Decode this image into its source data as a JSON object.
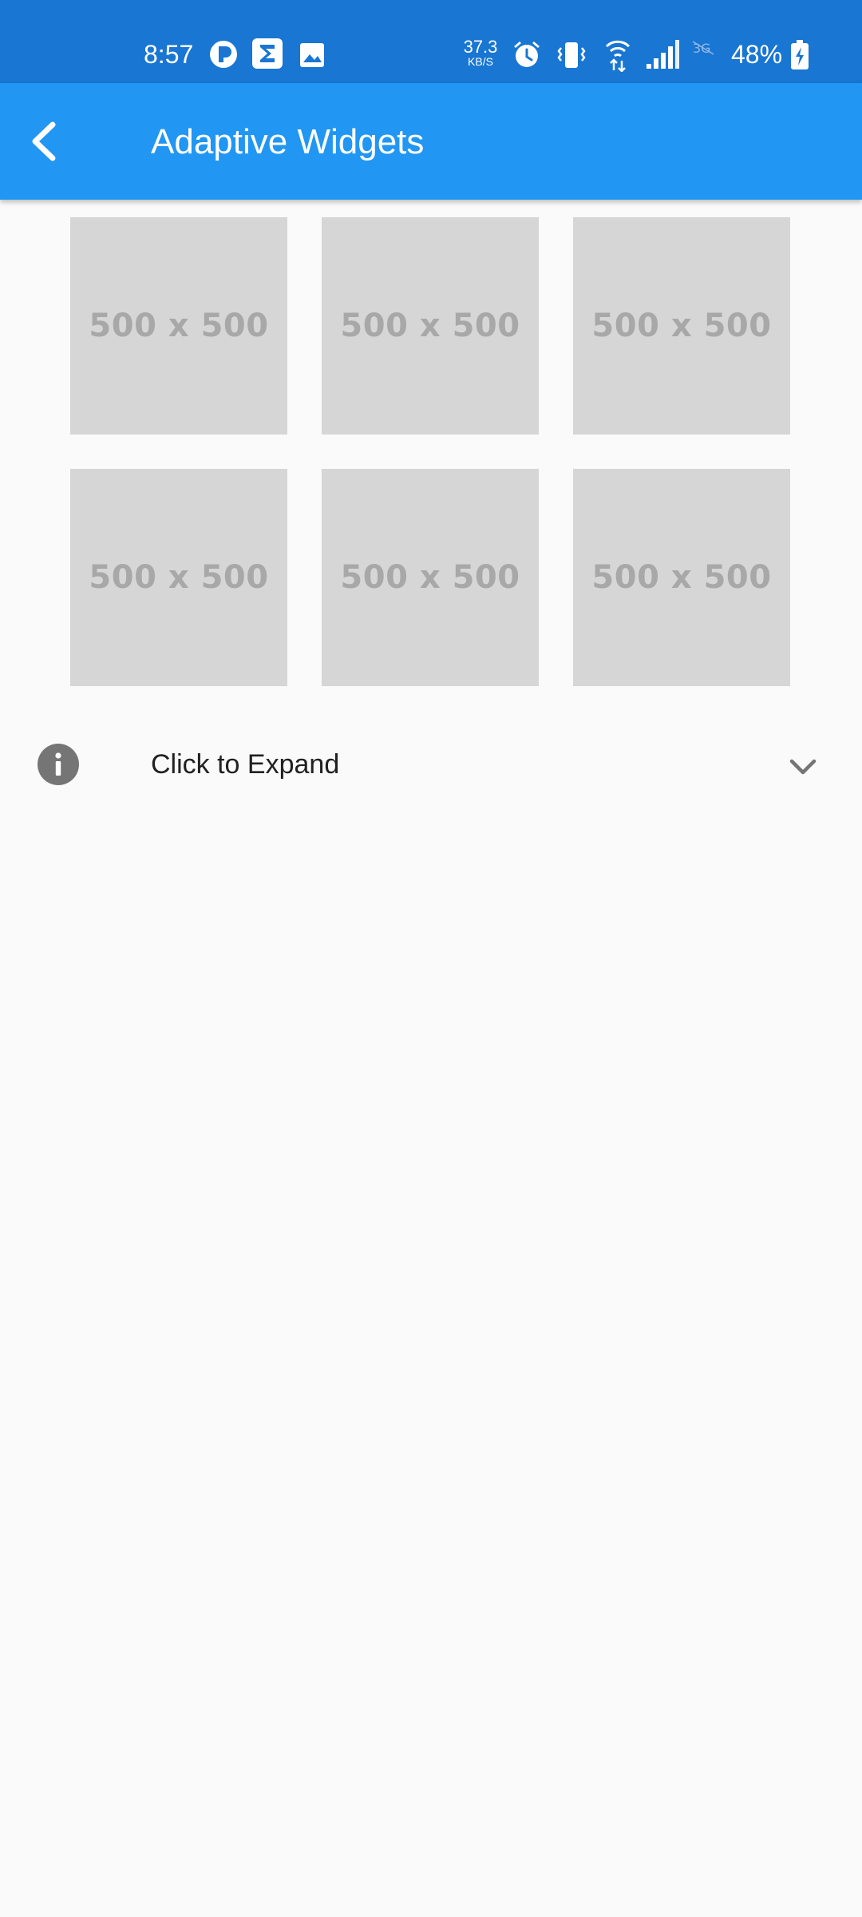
{
  "status_bar": {
    "time": "8:57",
    "net_speed_value": "37.3",
    "net_speed_unit": "KB/S",
    "battery_percent": "48%",
    "icons": [
      "pocket-casts-icon",
      "sigma-icon",
      "gallery-icon",
      "alarm-icon",
      "vibrate-icon",
      "wifi-icon",
      "signal-icon",
      "3g-off-icon",
      "battery-charging-icon"
    ],
    "bar_color": "#1976D2"
  },
  "app_bar": {
    "title": "Adaptive Widgets",
    "back_icon": "chevron-left-icon",
    "color": "#2196F3"
  },
  "grid": {
    "tiles": [
      {
        "label": "500 x 500"
      },
      {
        "label": "500 x 500"
      },
      {
        "label": "500 x 500"
      },
      {
        "label": "500 x 500"
      },
      {
        "label": "500 x 500"
      },
      {
        "label": "500 x 500"
      }
    ]
  },
  "expansion": {
    "label": "Click to Expand",
    "leading_icon": "info-icon",
    "trailing_icon": "chevron-down-icon",
    "expanded": false
  }
}
